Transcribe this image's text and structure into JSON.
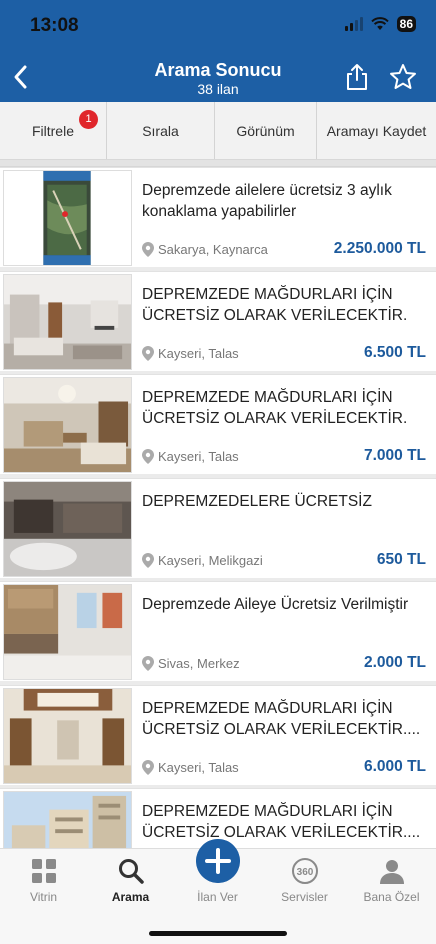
{
  "status_bar": {
    "time": "13:08",
    "battery": "86"
  },
  "header": {
    "title": "Arama Sonucu",
    "subtitle": "38 ilan",
    "back_icon": "chevron-left-icon",
    "share_icon": "share-icon",
    "favorite_icon": "star-icon"
  },
  "filters": [
    {
      "label": "Filtrele",
      "badge": "1"
    },
    {
      "label": "Sırala"
    },
    {
      "label": "Görünüm"
    },
    {
      "label": "Aramayı Kaydet"
    }
  ],
  "listings": [
    {
      "title": "Depremzede ailelere ücretsiz 3 aylık konaklama yapabilirler",
      "location": "Sakarya, Kaynarca",
      "price": "2.250.000 TL"
    },
    {
      "title": "DEPREMZEDE MAĞDURLARI İÇİN ÜCRETSİZ OLARAK VERİLECEKTİR.",
      "location": "Kayseri, Talas",
      "price": "6.500 TL"
    },
    {
      "title": "DEPREMZEDE MAĞDURLARI İÇİN ÜCRETSİZ OLARAK VERİLECEKTİR.",
      "location": "Kayseri, Talas",
      "price": "7.000 TL"
    },
    {
      "title": "DEPREMZEDELERE ÜCRETSİZ",
      "location": "Kayseri, Melikgazi",
      "price": "650 TL"
    },
    {
      "title": "Depremzede Aileye Ücretsiz Verilmiştir",
      "location": "Sivas, Merkez",
      "price": "2.000 TL"
    },
    {
      "title": "DEPREMZEDE MAĞDURLARI İÇİN ÜCRETSİZ OLARAK VERİLECEKTİR....",
      "location": "Kayseri, Talas",
      "price": "6.000 TL"
    },
    {
      "title": "DEPREMZEDE MAĞDURLARI İÇİN ÜCRETSİZ OLARAK VERİLECEKTİR....",
      "location": "",
      "price": ""
    }
  ],
  "tabs": [
    {
      "label": "Vitrin",
      "icon": "grid-icon"
    },
    {
      "label": "Arama",
      "icon": "search-icon"
    },
    {
      "label": "İlan Ver",
      "icon": "plus-icon"
    },
    {
      "label": "Servisler",
      "icon": "360-icon"
    },
    {
      "label": "Bana Özel",
      "icon": "user-icon"
    }
  ],
  "colors": {
    "brand": "#1d5fa5",
    "price": "#1d5a9c",
    "badge": "#e0262b"
  }
}
